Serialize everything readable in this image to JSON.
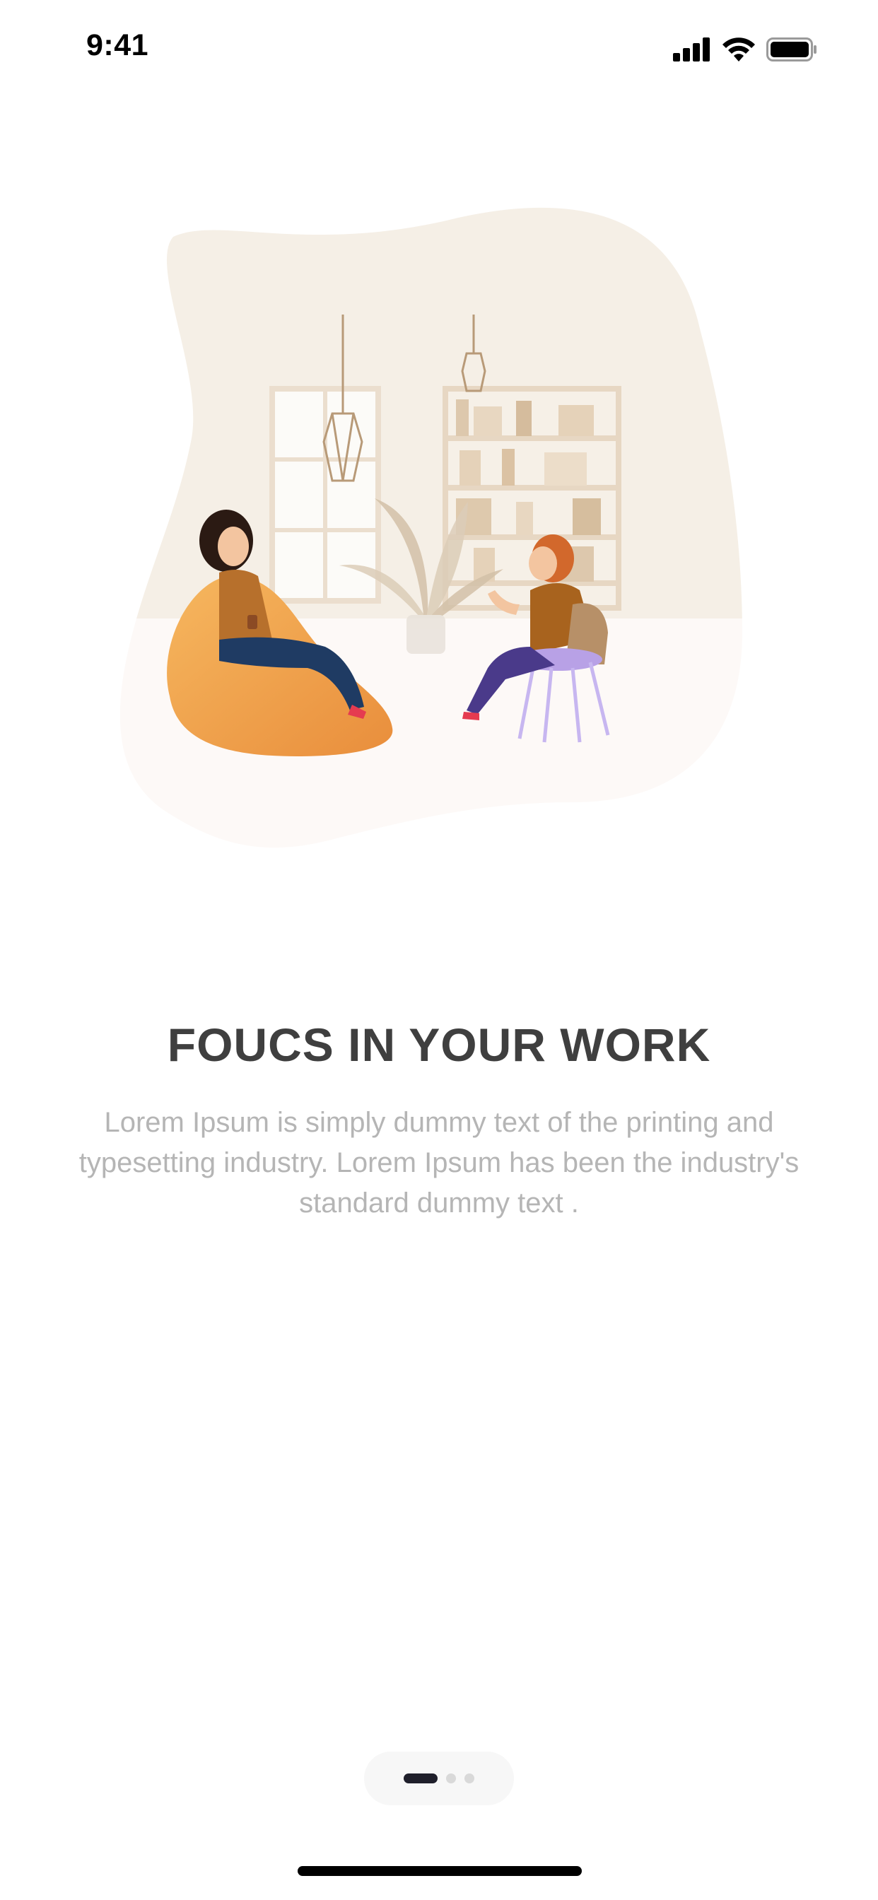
{
  "status_bar": {
    "time": "9:41",
    "battery_level": 1.0
  },
  "illustration": {
    "name": "two-people-chatting-illustration"
  },
  "onboarding": {
    "title": "FOUCS IN YOUR WORK",
    "description": "Lorem Ipsum is simply dummy text of the printing and typesetting industry. Lorem Ipsum has been the industry's standard dummy text ."
  },
  "pager": {
    "total_pages": 3,
    "current_page": 1
  },
  "colors": {
    "title": "#3f3f3f",
    "description": "#b5b5b5",
    "active_dot": "#1f1f2b",
    "inactive_dot": "#d9d9d9",
    "blob_top": "#f5efe6",
    "blob_bottom": "#fdf9f7"
  }
}
